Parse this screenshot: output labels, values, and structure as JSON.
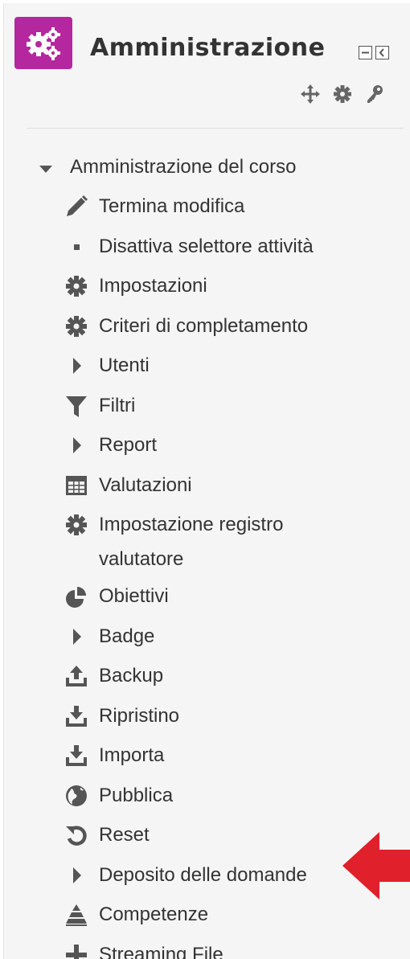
{
  "block": {
    "title": "Amministrazione",
    "accent_color": "#b5279e",
    "icon": "cogs-icon",
    "dock_icons": [
      "minimize-icon",
      "dock-left-icon"
    ],
    "control_icons": [
      "move-icon",
      "gear-icon",
      "key-icon"
    ]
  },
  "tree": {
    "root_label": "Amministrazione del corso",
    "root_icon": "caret-down-icon",
    "items": [
      {
        "label": "Termina modifica",
        "icon": "pencil-icon"
      },
      {
        "label": "Disattiva selettore attività",
        "icon": "bullet-icon"
      },
      {
        "label": "Impostazioni",
        "icon": "gear-icon"
      },
      {
        "label": "Criteri di completamento",
        "icon": "gear-icon"
      },
      {
        "label": "Utenti",
        "icon": "caret-right-icon"
      },
      {
        "label": "Filtri",
        "icon": "filter-icon"
      },
      {
        "label": "Report",
        "icon": "caret-right-icon"
      },
      {
        "label": "Valutazioni",
        "icon": "table-icon"
      },
      {
        "label": "Impostazione registro valutatore",
        "icon": "gear-icon"
      },
      {
        "label": "Obiettivi",
        "icon": "pie-icon"
      },
      {
        "label": "Badge",
        "icon": "caret-right-icon"
      },
      {
        "label": "Backup",
        "icon": "upload-icon"
      },
      {
        "label": "Ripristino",
        "icon": "download-icon"
      },
      {
        "label": "Importa",
        "icon": "download-icon"
      },
      {
        "label": "Pubblica",
        "icon": "globe-icon"
      },
      {
        "label": "Reset",
        "icon": "reset-icon"
      },
      {
        "label": "Deposito delle domande",
        "icon": "caret-right-icon"
      },
      {
        "label": "Competenze",
        "icon": "competency-icon"
      },
      {
        "label": "Streaming File",
        "icon": "plus-icon"
      }
    ]
  },
  "annotation": {
    "icon": "red-arrow-icon",
    "color": "#e0202a"
  }
}
